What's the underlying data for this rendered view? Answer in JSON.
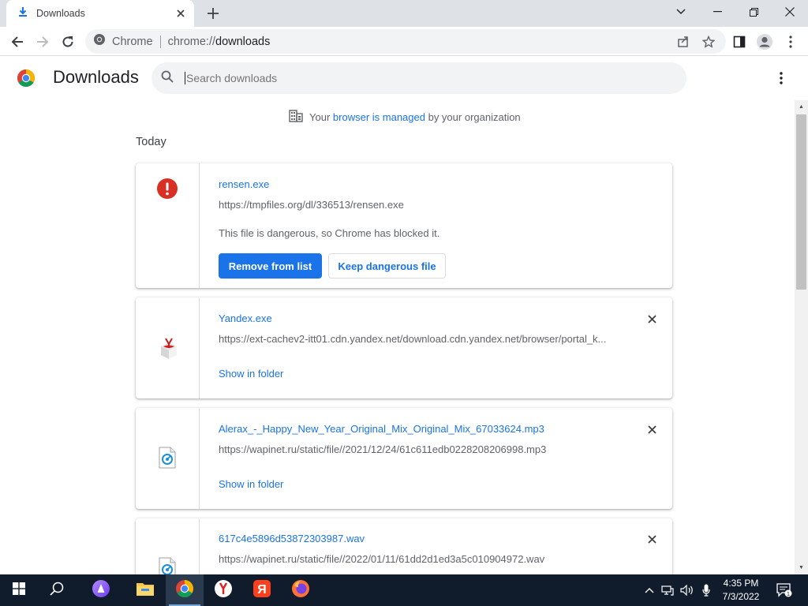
{
  "tab": {
    "title": "Downloads"
  },
  "omnibox": {
    "scheme_label": "Chrome",
    "url_prefix": "chrome://",
    "url_host": "downloads"
  },
  "header": {
    "title": "Downloads",
    "search_placeholder": "Search downloads"
  },
  "managed_notice": {
    "prefix": "Your",
    "link": "browser is managed",
    "suffix": "by your organization"
  },
  "section_label": "Today",
  "downloads": [
    {
      "filename": "rensen.exe",
      "url": "https://tmpfiles.org/dl/336513/rensen.exe",
      "description": "This file is dangerous, so Chrome has blocked it.",
      "primary_action": "Remove from list",
      "secondary_action": "Keep dangerous file",
      "icon": "danger-icon"
    },
    {
      "filename": "Yandex.exe",
      "url": "https://ext-cachev2-itt01.cdn.yandex.net/download.cdn.yandex.net/browser/portal_k...",
      "action": "Show in folder",
      "icon": "yandex-installer-icon"
    },
    {
      "filename": "Alerax_-_Happy_New_Year_Original_Mix_Original_Mix_67033624.mp3",
      "url": "https://wapinet.ru/static/file//2021/12/24/61c611edb0228208206998.mp3",
      "action": "Show in folder",
      "icon": "audio-file-icon"
    },
    {
      "filename": "617c4e5896d53872303987.wav",
      "url": "https://wapinet.ru/static/file//2022/01/11/61dd2d1ed3a5c010904972.wav",
      "icon": "audio-file-icon"
    }
  ],
  "taskbar": {
    "time": "4:35 PM",
    "date": "7/3/2022",
    "notification_count": "1",
    "apps": [
      "start-icon",
      "search-icon",
      "alice-icon",
      "file-explorer-icon",
      "chrome-icon",
      "yandex-browser-icon",
      "yandex-icon",
      "firefox-icon"
    ]
  },
  "colors": {
    "accent": "#1a73e8",
    "danger": "#d93025",
    "taskbar": "#101b2b"
  }
}
